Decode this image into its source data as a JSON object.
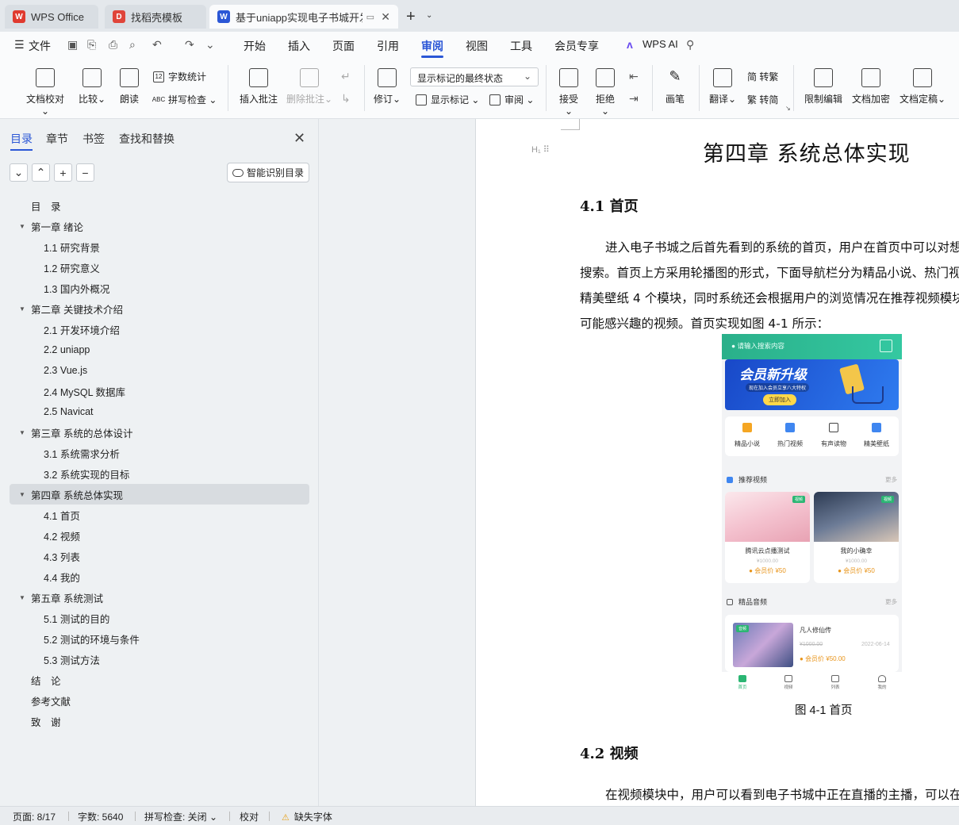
{
  "tabs": [
    {
      "label": "WPS Office",
      "icon": "wps-logo-icon",
      "color": "#e03a2f"
    },
    {
      "label": "找稻壳模板",
      "icon": "docer-icon",
      "color": "#e0453a"
    },
    {
      "label": "基于uniapp实现电子书城开发",
      "icon": "word-doc-icon",
      "color": "#2b57d6"
    }
  ],
  "menu": {
    "file": "文件",
    "items": [
      "开始",
      "插入",
      "页面",
      "引用",
      "审阅",
      "视图",
      "工具",
      "会员专享"
    ],
    "active": "审阅",
    "ai": "WPS AI"
  },
  "ribbon": {
    "proofread": "文档校对",
    "compare": "比较",
    "read_aloud": "朗读",
    "word_count": "字数统计",
    "spell_check": "拼写检查",
    "insert_comment": "插入批注",
    "delete_comment": "删除批注",
    "track_changes": "修订",
    "markup_state": "显示标记的最终状态",
    "show_markup": "显示标记",
    "review": "审阅",
    "accept": "接受",
    "reject": "拒绝",
    "pen": "画笔",
    "translate": "翻译",
    "to_traditional": "简 转繁",
    "to_simplified": "繁 转简",
    "restrict_edit": "限制编辑",
    "encrypt": "文档加密",
    "finalize": "文档定稿"
  },
  "nav": {
    "tabs": [
      "目录",
      "章节",
      "书签",
      "查找和替换"
    ],
    "active_tab": "目录",
    "smart_toc": "智能识别目录",
    "toc": [
      {
        "label": "目　录",
        "level": 1,
        "arrow": false
      },
      {
        "label": "第一章  绪论",
        "level": 1,
        "arrow": true
      },
      {
        "label": "1.1  研究背景",
        "level": 2
      },
      {
        "label": "1.2  研究意义",
        "level": 2
      },
      {
        "label": "1.3  国内外概况",
        "level": 2
      },
      {
        "label": "第二章  关键技术介绍",
        "level": 1,
        "arrow": true
      },
      {
        "label": "2.1  开发环境介绍",
        "level": 2
      },
      {
        "label": "2.2 uniapp",
        "level": 2
      },
      {
        "label": "2.3 Vue.js",
        "level": 2
      },
      {
        "label": "2.4 MySQL 数据库",
        "level": 2
      },
      {
        "label": "2.5 Navicat",
        "level": 2
      },
      {
        "label": "第三章  系统的总体设计",
        "level": 1,
        "arrow": true
      },
      {
        "label": "3.1  系统需求分析",
        "level": 2
      },
      {
        "label": "3.2  系统实现的目标",
        "level": 2
      },
      {
        "label": "第四章  系统总体实现",
        "level": 1,
        "arrow": true,
        "selected": true
      },
      {
        "label": "4.1  首页",
        "level": 2
      },
      {
        "label": "4.2  视频",
        "level": 2
      },
      {
        "label": "4.3  列表",
        "level": 2
      },
      {
        "label": "4.4  我的",
        "level": 2
      },
      {
        "label": "第五章  系统测试",
        "level": 1,
        "arrow": true
      },
      {
        "label": "5.1  测试的目的",
        "level": 2
      },
      {
        "label": "5.2  测试的环境与条件",
        "level": 2
      },
      {
        "label": "5.3  测试方法",
        "level": 2
      },
      {
        "label": "结　论",
        "level": 1,
        "arrow": false
      },
      {
        "label": "参考文献",
        "level": 1,
        "arrow": false
      },
      {
        "label": "致　谢",
        "level": 1,
        "arrow": false
      }
    ]
  },
  "doc": {
    "chapter_title": "第四章  系统总体实现",
    "heading_handle": "H₁",
    "section1": "4.1  首页",
    "para1": [
      "进入电子书城之后首先看到的系统的首页，用户在首页中可以对想",
      "搜索。首页上方采用轮播图的形式，下面导航栏分为精品小说、热门视",
      "精美壁纸 4 个模块，同时系统还会根据用户的浏览情况在推荐视频模块",
      "可能感兴趣的视频。首页实现如图 4-1 所示："
    ],
    "figure_caption": "图 4-1  首页",
    "section2": "4.2  视频",
    "para2_first": "在视频模块中，用户可以看到电子书城中正在直播的主播，可以在"
  },
  "phone": {
    "search_placeholder": "请输入搜索内容",
    "banner_title": "会员新升级",
    "banner_sub": "现在加入会员立享八大特权",
    "banner_btn": "立即加入",
    "categories": [
      {
        "label": "精品小说",
        "color": "#f5a623"
      },
      {
        "label": "热门视频",
        "color": "#3f86f0"
      },
      {
        "label": "有声读物",
        "color": "#444444"
      },
      {
        "label": "精美壁纸",
        "color": "#3f86f0"
      }
    ],
    "rec_title": "推荐视频",
    "more": "更多",
    "cards": [
      {
        "title": "腾讯云点播测试",
        "price": "¥1000.00",
        "vip": "会员价 ¥50",
        "badge": "视频"
      },
      {
        "title": "我的小确幸",
        "price": "¥1000.00",
        "vip": "会员价 ¥50",
        "badge": "视频"
      }
    ],
    "audio_title": "精品音频",
    "audio": {
      "badge": "音频",
      "title": "凡人修仙传",
      "orig": "¥1000.00",
      "date": "2022-06-14",
      "vip": "会员价 ¥50.00"
    },
    "nav": [
      "首页",
      "视频",
      "列表",
      "我的"
    ]
  },
  "status": {
    "page": "页面: 8/17",
    "words": "字数: 5640",
    "spell": "拼写检查: 关闭",
    "proof": "校对",
    "missing_font": "缺失字体"
  }
}
